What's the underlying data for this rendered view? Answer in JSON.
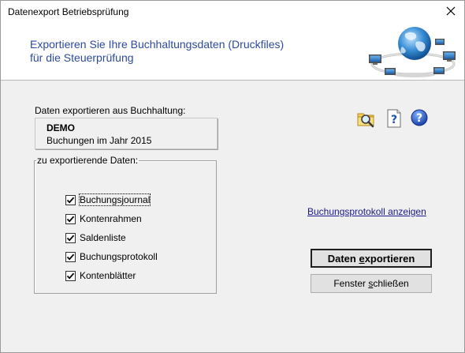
{
  "window": {
    "title": "Datenexport Betriebsprüfung",
    "close_icon": "close-icon"
  },
  "header": {
    "line1": "Exportieren Sie Ihre Buchhaltungsdaten (Druckfiles)",
    "line2": "für die Steuerprüfung",
    "text_color": "#2d4aa0",
    "image_icon": "network-globe-icon"
  },
  "source": {
    "label": "Daten exportieren aus Buchhaltung:",
    "name": "DEMO",
    "description": "Buchungen im Jahr 2015"
  },
  "toolbar": {
    "icons": [
      "folder-search-icon",
      "help-document-icon",
      "help-circle-icon"
    ]
  },
  "export_group": {
    "legend": "zu exportierende Daten:",
    "items": [
      {
        "label": "Buchungsjournal",
        "checked": true
      },
      {
        "label": "Kontenrahmen",
        "checked": true
      },
      {
        "label": "Saldenliste",
        "checked": true
      },
      {
        "label": "Buchungsprotokoll",
        "checked": true
      },
      {
        "label": "Kontenblätter",
        "checked": true
      }
    ]
  },
  "actions": {
    "protocol_link": "Buchungsprotokoll anzeigen",
    "export_label_pre": "Daten ",
    "export_label_accel": "e",
    "export_label_post": "xportieren",
    "close_label_pre": "Fenster ",
    "close_label_accel": "s",
    "close_label_post": "chließen"
  }
}
